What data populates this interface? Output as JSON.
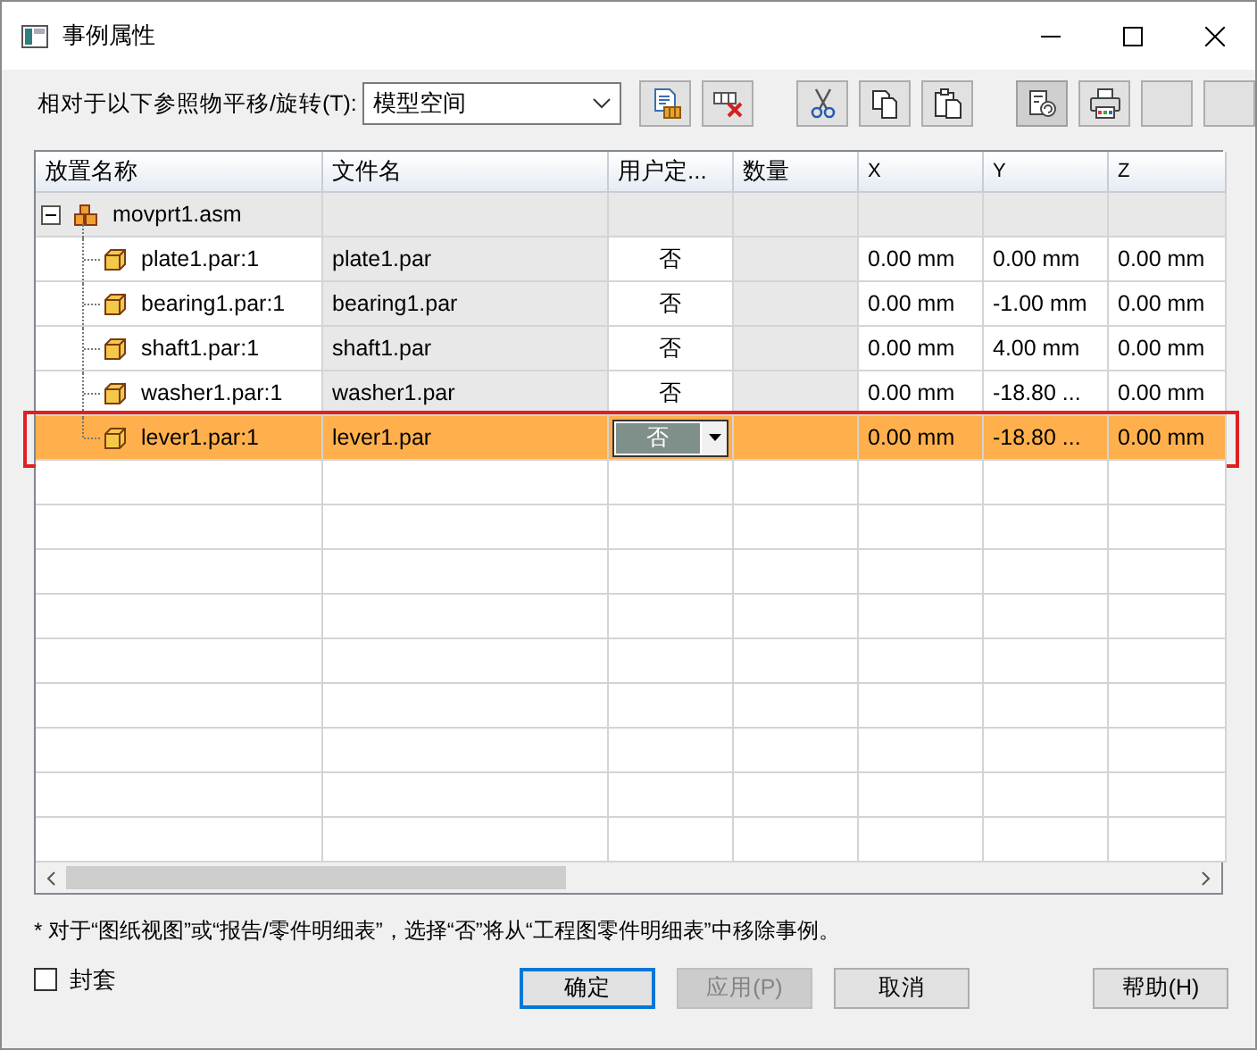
{
  "window": {
    "title": "事例属性"
  },
  "toolbar": {
    "label": "相对于以下参照物平移/旋转(T):",
    "reference": {
      "value": "模型空间"
    },
    "buttons": [
      {
        "kind": "properties",
        "pressed": false
      },
      {
        "kind": "delete",
        "pressed": false
      },
      {
        "kind": "cut",
        "pressed": false
      },
      {
        "kind": "copy",
        "pressed": false
      },
      {
        "kind": "paste",
        "pressed": false
      },
      {
        "kind": "reset",
        "pressed": true
      },
      {
        "kind": "print",
        "pressed": false
      },
      {
        "kind": "blank",
        "pressed": false
      },
      {
        "kind": "blank",
        "pressed": false
      }
    ]
  },
  "table": {
    "columns": [
      "放置名称",
      "文件名",
      "用户定...",
      "数量",
      "X",
      "Y",
      "Z"
    ],
    "rows": [
      {
        "name": "movprt1.asm",
        "kind": "assembly",
        "expanded": true,
        "children": [
          {
            "name": "plate1.par:1",
            "kind": "part",
            "file": "plate1.par",
            "user_defined": "否",
            "x": "0.00 mm",
            "y": "0.00 mm",
            "z": "0.00 mm",
            "selected": false
          },
          {
            "name": "bearing1.par:1",
            "kind": "part",
            "file": "bearing1.par",
            "user_defined": "否",
            "x": "0.00 mm",
            "y": "-1.00 mm",
            "z": "0.00 mm",
            "selected": false
          },
          {
            "name": "shaft1.par:1",
            "kind": "part",
            "file": "shaft1.par",
            "user_defined": "否",
            "x": "0.00 mm",
            "y": "4.00 mm",
            "z": "0.00 mm",
            "selected": false
          },
          {
            "name": "washer1.par:1",
            "kind": "part",
            "file": "washer1.par",
            "user_defined": "否",
            "x": "0.00 mm",
            "y": "-18.80 ...",
            "z": "0.00 mm",
            "selected": false
          },
          {
            "name": "lever1.par:1",
            "kind": "part",
            "file": "lever1.par",
            "user_defined": "否",
            "x": "0.00 mm",
            "y": "-18.80 ...",
            "z": "0.00 mm",
            "selected": true
          }
        ]
      }
    ]
  },
  "note": "* 对于“图纸视图”或“报告/零件明细表”，选择“否”将从“工程图零件明细表”中移除事例。",
  "enclosure": {
    "label": "封套",
    "checked": false
  },
  "buttons": [
    {
      "label": "确定",
      "default": true,
      "disabled": false
    },
    {
      "label": "应用(P)",
      "default": false,
      "disabled": true
    },
    {
      "label": "取消",
      "default": false,
      "disabled": false
    },
    {
      "label": "帮助(H)",
      "default": false,
      "disabled": false
    }
  ]
}
